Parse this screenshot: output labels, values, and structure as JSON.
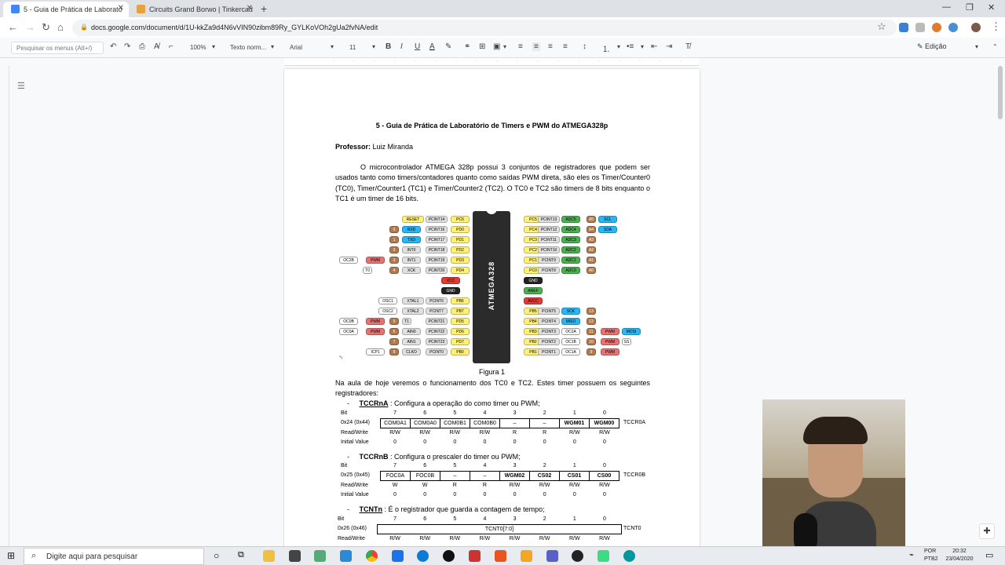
{
  "browser": {
    "tabs": [
      {
        "title": "5 - Guia de Prática de Laborató",
        "active": true,
        "icon": "docs-icon",
        "color": "#4285f4"
      },
      {
        "title": "Circuits Grand Borwo | Tinkercad",
        "active": false,
        "icon": "tinkercad-icon",
        "color": "#e9a23b"
      }
    ],
    "new_tab": "+",
    "url": "docs.google.com/document/d/1U-kkZa9d4N6vVIN90zibm89Ry_GYLKoVOh2gUa2fvNA/edit"
  },
  "docs_toolbar": {
    "menu_search_placeholder": "Pesquisar os menus (Alt+/)",
    "zoom": "100%",
    "style": "Texto norm...",
    "font": "Arial",
    "size": "11",
    "mode": "Edição"
  },
  "document": {
    "title": "5 - Guia de Prática de Laboratório de Timers e PWM do ATMEGA328p",
    "professor_label": "Professor:",
    "professor_name": "Luiz Miranda",
    "intro": "O microcontrolador ATMEGA 328p possui 3 conjuntos de registradores que podem ser usados tanto como timers/contadores quanto como saídas PWM direta, são eles os Timer/Counter0 (TC0), Timer/Counter1 (TC1) e Timer/Counter2 (TC2). O TC0 e TC2 são timers de 8 bits enquanto o TC1 é um timer de 16 bits.",
    "figure_caption": "Figura 1",
    "chip_label": "ATMEGA328",
    "body2": "Na aula de hoje veremos o funcionamento dos TC0 e TC2. Estes timer possuem os seguintes registradores:",
    "bullets": [
      {
        "name": "TCCRnA",
        "desc": ": Configura a operação do como timer ou PWM;"
      },
      {
        "name": "TCCRnB",
        "desc": ": Configura o prescaler do timer ou PWM;"
      },
      {
        "name": "TCNTn",
        "desc": ": É o registrador que guarda a contagem de tempo;"
      }
    ],
    "registers": [
      {
        "addr": "0x24 (0x44)",
        "reg": "TCCR0A",
        "bits": [
          "7",
          "6",
          "5",
          "4",
          "3",
          "2",
          "1",
          "0"
        ],
        "cells": [
          "COM0A1",
          "COM0A0",
          "COM0B1",
          "COM0B0",
          "–",
          "–",
          "WGM01",
          "WGM00"
        ],
        "rw": [
          "R/W",
          "R/W",
          "R/W",
          "R/W",
          "R",
          "R",
          "R/W",
          "R/W"
        ],
        "init": [
          "0",
          "0",
          "0",
          "0",
          "0",
          "0",
          "0",
          "0"
        ]
      },
      {
        "addr": "0x25 (0x45)",
        "reg": "TCCR0B",
        "bits": [
          "7",
          "6",
          "5",
          "4",
          "3",
          "2",
          "1",
          "0"
        ],
        "cells": [
          "FOC0A",
          "FOC0B",
          "–",
          "–",
          "WGM02",
          "CS02",
          "CS01",
          "CS00"
        ],
        "rw": [
          "W",
          "W",
          "R",
          "R",
          "R/W",
          "R/W",
          "R/W",
          "R/W"
        ],
        "init": [
          "0",
          "0",
          "0",
          "0",
          "0",
          "0",
          "0",
          "0"
        ]
      },
      {
        "addr": "0x26 (0x46)",
        "reg": "TCNT0",
        "bits": [
          "7",
          "6",
          "5",
          "4",
          "3",
          "2",
          "1",
          "0"
        ],
        "cells": [
          "TCNT0[7:0]"
        ],
        "rw": [
          "R/W",
          "R/W",
          "R/W",
          "R/W",
          "R/W",
          "R/W",
          "R/W",
          "R/W"
        ]
      }
    ],
    "row_labels": {
      "bit": "Bit",
      "rw": "Read/Write",
      "init": "Initial Value"
    }
  },
  "taskbar": {
    "search_placeholder": "Digite aqui para pesquisar",
    "lang": "POR",
    "kbd": "PTB2",
    "time": "20:32",
    "date": "23/04/2020"
  }
}
